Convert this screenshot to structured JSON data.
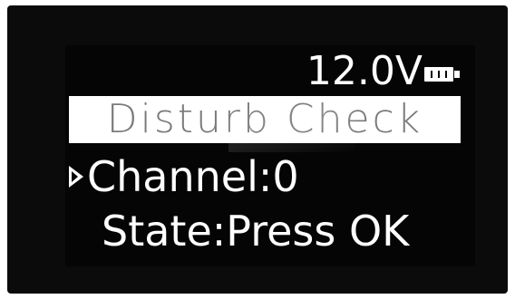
{
  "status": {
    "voltage": "12.0V",
    "battery_icon": "battery-full-icon"
  },
  "title": "Disturb Check",
  "menu": {
    "selector_icon": "right-triangle-icon",
    "channel_text": "Channel:0",
    "state_text": "State:Press OK"
  },
  "colors": {
    "screen_bg": "#050505",
    "text": "#ffffff",
    "title_bar_bg": "#ffffff",
    "title_text": "#7a7a7a"
  }
}
